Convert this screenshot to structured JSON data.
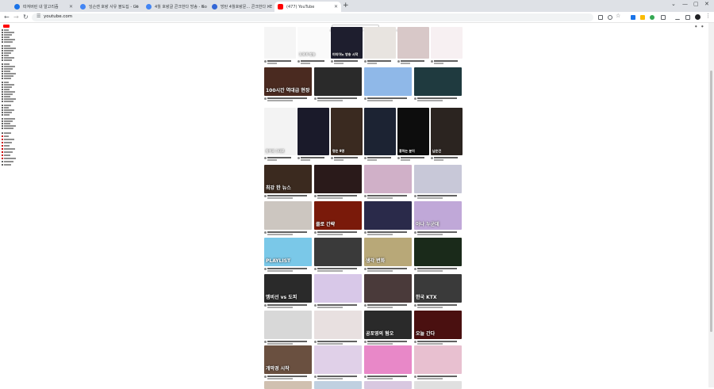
{
  "browser": {
    "tabs": [
      {
        "title": "따져버린 내 알고리즘",
        "favicon_color": "#1a73e8"
      },
      {
        "title": "잉슨캔 호랑 사유 블도집 - Go",
        "favicon_color": "#4285f4"
      },
      {
        "title": "4월 호랑글 콘크한다 방송 - Go",
        "favicon_color": "#4285f4"
      },
      {
        "title": "방탄 4월호랑문... 콘크한다 : E",
        "favicon_color": "#3367d6"
      },
      {
        "title": "(477) YouTube",
        "favicon_color": "#ff0000",
        "active": true
      }
    ],
    "new_tab_symbol": "+",
    "url": "youtube.com",
    "window_controls": [
      "⌄",
      "—",
      "▢",
      "✕"
    ]
  },
  "youtube": {
    "section_label": "Shorts",
    "videos": [
      {
        "title": "",
        "color": "#f5f5f5",
        "overlay": ""
      },
      {
        "title": "",
        "color": "#fafafa",
        "overlay": "1:8:0 방송"
      },
      {
        "title": "",
        "color": "#1e1e2e",
        "overlay": "미티아노 방송 시작"
      },
      {
        "title": "",
        "color": "#e8e4e0",
        "overlay": ""
      },
      {
        "title": "",
        "color": "#d8c8c8",
        "overlay": ""
      },
      {
        "title": "",
        "color": "#f7f0f2",
        "overlay": ""
      },
      {
        "title": "",
        "color": "#4a2a20",
        "overlay": "100시간 역대급 현장"
      },
      {
        "title": "",
        "color": "#2a2a2a",
        "overlay": ""
      },
      {
        "title": "",
        "color": "#8fb8e8",
        "overlay": ""
      },
      {
        "title": "",
        "color": "#1f3a3f",
        "overlay": ""
      },
      {
        "title": "",
        "color": "#f3f3f3",
        "overlay": "동이의 그대로"
      },
      {
        "title": "",
        "color": "#1a1a2a",
        "overlay": ""
      },
      {
        "title": "",
        "color": "#3a2a20",
        "overlay": "명은 9명"
      },
      {
        "title": "",
        "color": "#1c2333",
        "overlay": ""
      },
      {
        "title": "",
        "color": "#0d0d0d",
        "overlay": "흥하는 분이"
      },
      {
        "title": "",
        "color": "#2b2420",
        "overlay": "남은건"
      },
      {
        "title": "",
        "color": "#3b2a1f",
        "overlay": "최강 한 뉴스"
      },
      {
        "title": "",
        "color": "#2a1a1a",
        "overlay": ""
      },
      {
        "title": "",
        "color": "#d0b0c8",
        "overlay": ""
      },
      {
        "title": "",
        "color": "#c8c8d8",
        "overlay": ""
      },
      {
        "title": "",
        "color": "#ccc6c0",
        "overlay": ""
      },
      {
        "title": "",
        "color": "#7a1a0a",
        "overlay": "클로 간략"
      },
      {
        "title": "",
        "color": "#2a2a4a",
        "overlay": ""
      },
      {
        "title": "",
        "color": "#c0a8d8",
        "overlay": "아나 누군데"
      },
      {
        "title": "",
        "color": "#7ac8e8",
        "overlay": "PLAYLIST"
      },
      {
        "title": "",
        "color": "#3a3a3a",
        "overlay": ""
      },
      {
        "title": "",
        "color": "#b8a878",
        "overlay": "생각 변화"
      },
      {
        "title": "",
        "color": "#1a2a1a",
        "overlay": ""
      },
      {
        "title": "",
        "color": "#2a2a2a",
        "overlay": "엠비선 vs 도피"
      },
      {
        "title": "",
        "color": "#d8c8e8",
        "overlay": ""
      },
      {
        "title": "",
        "color": "#4a3a3a",
        "overlay": ""
      },
      {
        "title": "",
        "color": "#3a3a3a",
        "overlay": "한국 KTX"
      },
      {
        "title": "",
        "color": "#d8d8d8",
        "overlay": ""
      },
      {
        "title": "",
        "color": "#e8e0e0",
        "overlay": ""
      },
      {
        "title": "",
        "color": "#2a2a2a",
        "overlay": "공포영의 혐오"
      },
      {
        "title": "",
        "color": "#4a1010",
        "overlay": "오늘 간다"
      },
      {
        "title": "",
        "color": "#6a5040",
        "overlay": "개막경 시작"
      },
      {
        "title": "",
        "color": "#e0d0e8",
        "overlay": ""
      },
      {
        "title": "",
        "color": "#e888c8",
        "overlay": ""
      },
      {
        "title": "",
        "color": "#e8c0d0",
        "overlay": ""
      },
      {
        "title": "",
        "color": "#d0c0b0",
        "overlay": ""
      },
      {
        "title": "",
        "color": "#c0d0e0",
        "overlay": ""
      },
      {
        "title": "",
        "color": "#d8c8e0",
        "overlay": ""
      },
      {
        "title": "",
        "color": "#e0e0e0",
        "overlay": ""
      }
    ]
  }
}
